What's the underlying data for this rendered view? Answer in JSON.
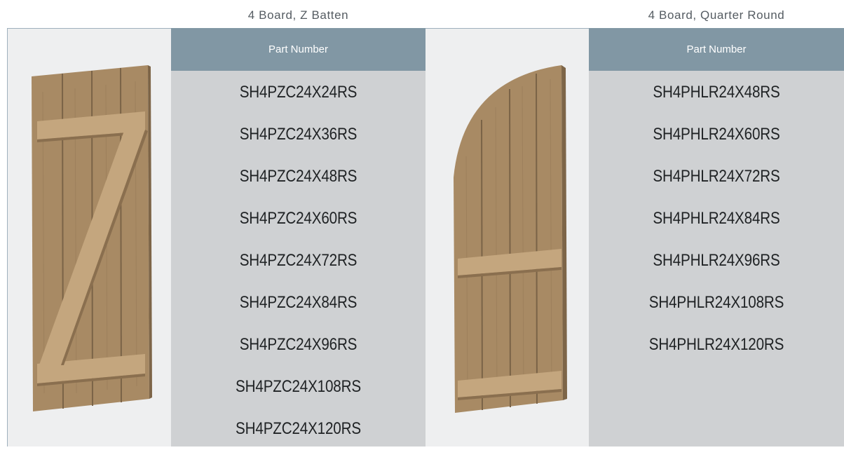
{
  "products": [
    {
      "title": "4 Board, Z Batten",
      "image": "z-batten-board-shutter",
      "header": "Part Number",
      "parts": [
        "SH4PZC24X24RS",
        "SH4PZC24X36RS",
        "SH4PZC24X48RS",
        "SH4PZC24X60RS",
        "SH4PZC24X72RS",
        "SH4PZC24X84RS",
        "SH4PZC24X96RS",
        "SH4PZC24X108RS",
        "SH4PZC24X120RS"
      ]
    },
    {
      "title": "4 Board, Quarter Round",
      "image": "quarter-round-board-shutter",
      "header": "Part Number",
      "parts": [
        "SH4PHLR24X48RS",
        "SH4PHLR24X60RS",
        "SH4PHLR24X72RS",
        "SH4PHLR24X84RS",
        "SH4PHLR24X96RS",
        "SH4PHLR24X108RS",
        "SH4PHLR24X120RS"
      ]
    }
  ],
  "colors": {
    "header_bg": "#8197a4",
    "table_bg": "#cfd1d3",
    "image_bg": "#eeeff0",
    "wood": "#a88a64",
    "wood_light": "#c4a67e"
  }
}
